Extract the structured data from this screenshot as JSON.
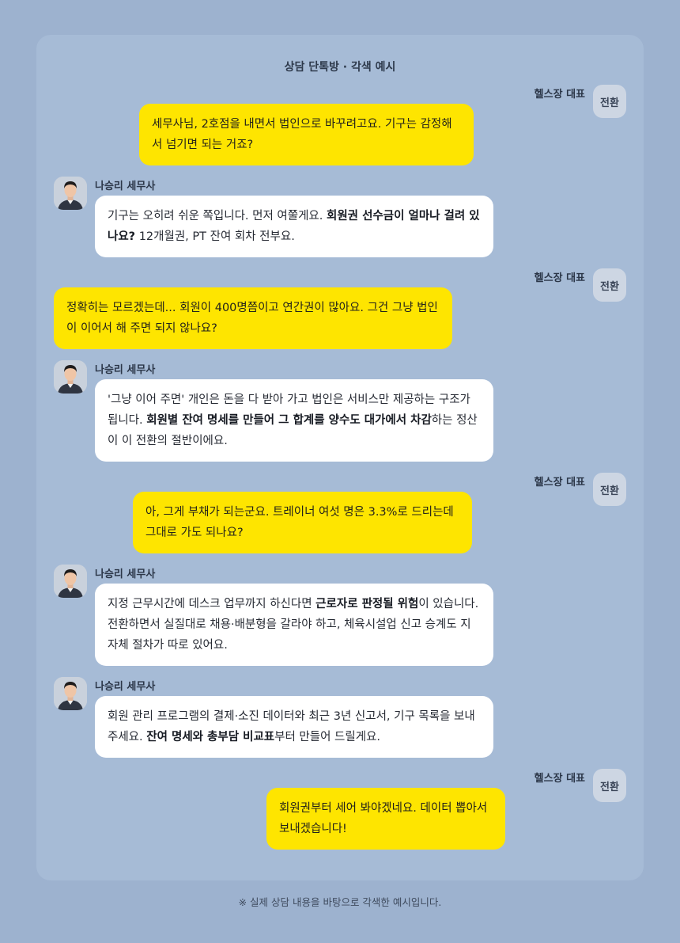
{
  "chat": {
    "title": "상담 단톡방 · 각색 예시",
    "client_name": "헬스장 대표",
    "client_avatar_label": "전환",
    "advisor_name": "나승리 세무사",
    "messages": [
      {
        "from": "client",
        "parts": [
          {
            "text": "세무사님, 2호점을 내면서 법인으로 바꾸려고요. 기구는 감정해서 넘기면 되는 거죠?",
            "bold": false
          }
        ]
      },
      {
        "from": "advisor",
        "parts": [
          {
            "text": "기구는 오히려 쉬운 쪽입니다. 먼저 여쭐게요. ",
            "bold": false
          },
          {
            "text": "회원권 선수금이 얼마나 걸려 있나요?",
            "bold": true
          },
          {
            "text": " 12개월권, PT 잔여 회차 전부요.",
            "bold": false
          }
        ]
      },
      {
        "from": "client",
        "parts": [
          {
            "text": "정확히는 모르겠는데... 회원이 400명쯤이고 연간권이 많아요. 그건 그냥 법인이 이어서 해 주면 되지 않나요?",
            "bold": false
          }
        ]
      },
      {
        "from": "advisor",
        "parts": [
          {
            "text": "'그냥 이어 주면' 개인은 돈을 다 받아 가고 법인은 서비스만 제공하는 구조가 됩니다. ",
            "bold": false
          },
          {
            "text": "회원별 잔여 명세를 만들어 그 합계를 양수도 대가에서 차감",
            "bold": true
          },
          {
            "text": "하는 정산이 이 전환의 절반이에요.",
            "bold": false
          }
        ]
      },
      {
        "from": "client",
        "parts": [
          {
            "text": "아, 그게 부채가 되는군요. 트레이너 여섯 명은 3.3%로 드리는데 그대로 가도 되나요?",
            "bold": false
          }
        ]
      },
      {
        "from": "advisor",
        "parts": [
          {
            "text": "지정 근무시간에 데스크 업무까지 하신다면 ",
            "bold": false
          },
          {
            "text": "근로자로 판정될 위험",
            "bold": true
          },
          {
            "text": "이 있습니다. 전환하면서 실질대로 채용·배분형을 갈라야 하고, 체육시설업 신고 승계도 지자체 절차가 따로 있어요.",
            "bold": false
          }
        ]
      },
      {
        "from": "advisor",
        "parts": [
          {
            "text": "회원 관리 프로그램의 결제·소진 데이터와 최근 3년 신고서, 기구 목록을 보내 주세요. ",
            "bold": false
          },
          {
            "text": "잔여 명세와 총부담 비교표",
            "bold": true
          },
          {
            "text": "부터 만들어 드릴게요.",
            "bold": false
          }
        ]
      },
      {
        "from": "client",
        "parts": [
          {
            "text": "회원권부터 세어 봐야겠네요. 데이터 뽑아서 보내겠습니다!",
            "bold": false
          }
        ]
      }
    ]
  },
  "footnote": "※ 실제 상담 내용을 바탕으로 각색한 예시입니다.",
  "colors": {
    "page_bg": "#9db2cf",
    "panel_bg": "#a6bbd6",
    "client_bubble": "#fee500",
    "advisor_bubble": "#ffffff",
    "client_avatar_bg": "#cdd6e3"
  },
  "icons": {
    "advisor_avatar": "person-portrait-icon"
  }
}
